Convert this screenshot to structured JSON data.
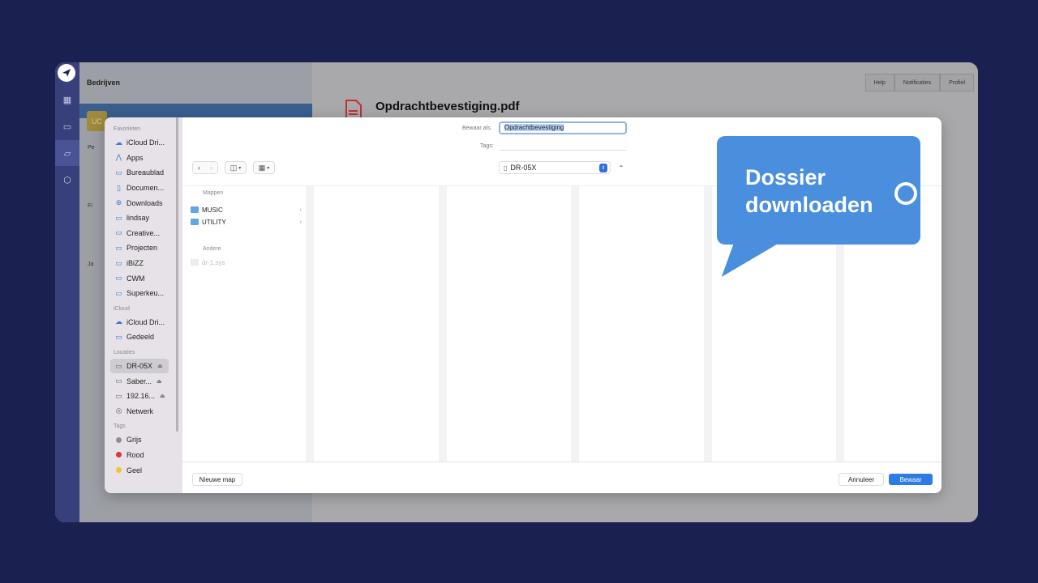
{
  "app": {
    "left_title": "Bedrijven",
    "avatar_text": "UC",
    "left_fragments": [
      "Pe",
      "Fi",
      "Ja"
    ],
    "top_buttons": [
      "Help",
      "Notificaties",
      "Profiel"
    ],
    "document_title": "Opdrachtbevestiging.pdf"
  },
  "dialog": {
    "save_as_label": "Bewaar als:",
    "save_as_value": "Opdrachtbevestiging",
    "tags_label": "Tags:",
    "location": "DR-05X",
    "sidebar": {
      "favorieten_label": "Favorieten",
      "favorieten": [
        {
          "label": "iCloud Dri...",
          "icon": "cloud-icon"
        },
        {
          "label": "Apps",
          "icon": "apps-icon"
        },
        {
          "label": "Bureaublad",
          "icon": "desktop-icon"
        },
        {
          "label": "Documen...",
          "icon": "document-icon"
        },
        {
          "label": "Downloads",
          "icon": "download-icon"
        },
        {
          "label": "lindsay",
          "icon": "folder-icon"
        },
        {
          "label": "Creative...",
          "icon": "folder-icon"
        },
        {
          "label": "Projecten",
          "icon": "folder-icon"
        },
        {
          "label": "iBiZZ",
          "icon": "folder-icon"
        },
        {
          "label": "CWM",
          "icon": "folder-icon"
        },
        {
          "label": "Superkeu...",
          "icon": "folder-icon"
        }
      ],
      "icloud_label": "iCloud",
      "icloud": [
        {
          "label": "iCloud Dri...",
          "icon": "cloud-icon"
        },
        {
          "label": "Gedeeld",
          "icon": "shared-folder-icon"
        }
      ],
      "locaties_label": "Locaties",
      "locaties": [
        {
          "label": "DR-05X",
          "icon": "drive-icon",
          "eject": true,
          "selected": true
        },
        {
          "label": "Saber...",
          "icon": "drive-icon",
          "eject": true
        },
        {
          "label": "192.16...",
          "icon": "monitor-icon",
          "eject": true
        },
        {
          "label": "Netwerk",
          "icon": "network-icon",
          "eject": false
        }
      ],
      "tags_label": "Tags",
      "tags": [
        {
          "label": "Grijs",
          "color": "#8e8e93"
        },
        {
          "label": "Rood",
          "color": "#e0342c"
        },
        {
          "label": "Geel",
          "color": "#f4c430"
        }
      ]
    },
    "browser": {
      "folders_label": "Mappen",
      "folders": [
        "MUSIC",
        "UTILITY"
      ],
      "other_label": "Andere",
      "other_files": [
        "dr-1.sys"
      ]
    },
    "new_folder_button": "Nieuwe map",
    "cancel_button": "Annuleer",
    "save_button": "Bewaar"
  },
  "callout": {
    "line1": "Dossier",
    "line2": "downloaden"
  }
}
